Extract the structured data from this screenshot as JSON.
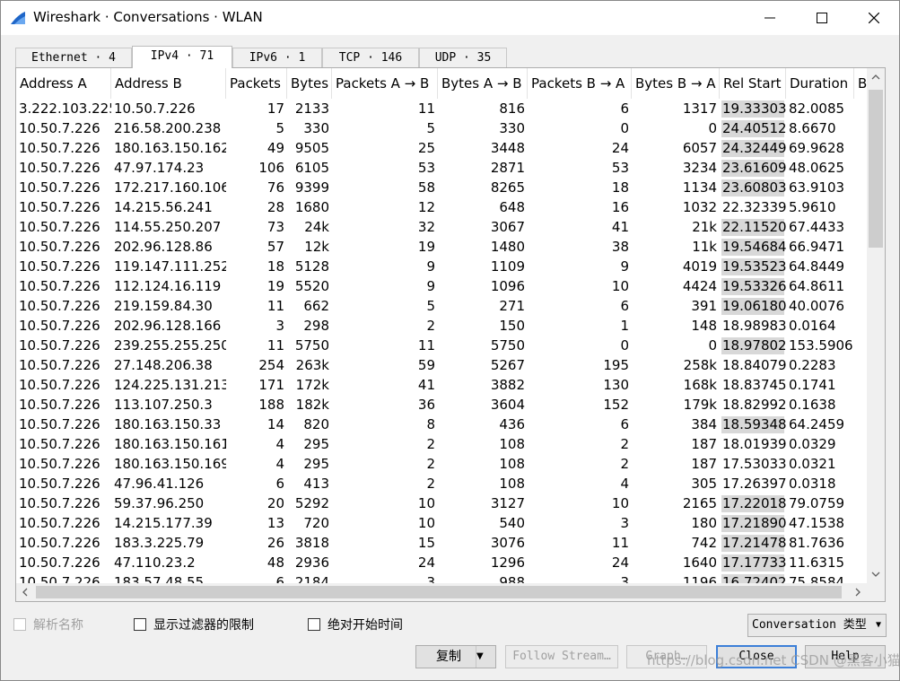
{
  "window": {
    "title": "Wireshark · Conversations · WLAN"
  },
  "tabs": [
    {
      "label": "Ethernet · 4"
    },
    {
      "label": "IPv4 · 71"
    },
    {
      "label": "IPv6 · 1"
    },
    {
      "label": "TCP · 146"
    },
    {
      "label": "UDP · 35"
    }
  ],
  "active_tab": "IPv4 · 71",
  "columns": [
    {
      "label": "Address A"
    },
    {
      "label": "Address B"
    },
    {
      "label": "Packets"
    },
    {
      "label": "Bytes"
    },
    {
      "label": "Packets A → B"
    },
    {
      "label": "Bytes A → B"
    },
    {
      "label": "Packets B → A"
    },
    {
      "label": "Bytes B → A"
    },
    {
      "label": "Rel Start"
    },
    {
      "label": "Duration"
    },
    {
      "label": "B"
    }
  ],
  "rows": [
    {
      "a": "3.222.103.225",
      "b": "10.50.7.226",
      "packets": "17",
      "bytes": "2133",
      "pab": "11",
      "bab": "816",
      "pba": "6",
      "bba": "1317",
      "rel": "19.333035",
      "dur": "82.0085",
      "shaded": true
    },
    {
      "a": "10.50.7.226",
      "b": "216.58.200.238",
      "packets": "5",
      "bytes": "330",
      "pab": "5",
      "bab": "330",
      "pba": "0",
      "bba": "0",
      "rel": "24.405121",
      "dur": "8.6670",
      "shaded": true
    },
    {
      "a": "10.50.7.226",
      "b": "180.163.150.162",
      "packets": "49",
      "bytes": "9505",
      "pab": "25",
      "bab": "3448",
      "pba": "24",
      "bba": "6057",
      "rel": "24.324493",
      "dur": "69.9628",
      "shaded": true
    },
    {
      "a": "10.50.7.226",
      "b": "47.97.174.23",
      "packets": "106",
      "bytes": "6105",
      "pab": "53",
      "bab": "2871",
      "pba": "53",
      "bba": "3234",
      "rel": "23.616092",
      "dur": "48.0625",
      "shaded": true
    },
    {
      "a": "10.50.7.226",
      "b": "172.217.160.106",
      "packets": "76",
      "bytes": "9399",
      "pab": "58",
      "bab": "8265",
      "pba": "18",
      "bba": "1134",
      "rel": "23.608031",
      "dur": "63.9103",
      "shaded": true
    },
    {
      "a": "10.50.7.226",
      "b": "14.215.56.241",
      "packets": "28",
      "bytes": "1680",
      "pab": "12",
      "bab": "648",
      "pba": "16",
      "bba": "1032",
      "rel": "22.323399",
      "dur": "5.9610",
      "shaded": false
    },
    {
      "a": "10.50.7.226",
      "b": "114.55.250.207",
      "packets": "73",
      "bytes": "24k",
      "pab": "32",
      "bab": "3067",
      "pba": "41",
      "bba": "21k",
      "rel": "22.115201",
      "dur": "67.4433",
      "shaded": true
    },
    {
      "a": "10.50.7.226",
      "b": "202.96.128.86",
      "packets": "57",
      "bytes": "12k",
      "pab": "19",
      "bab": "1480",
      "pba": "38",
      "bba": "11k",
      "rel": "19.546843",
      "dur": "66.9471",
      "shaded": true
    },
    {
      "a": "10.50.7.226",
      "b": "119.147.111.252",
      "packets": "18",
      "bytes": "5128",
      "pab": "9",
      "bab": "1109",
      "pba": "9",
      "bba": "4019",
      "rel": "19.535235",
      "dur": "64.8449",
      "shaded": true
    },
    {
      "a": "10.50.7.226",
      "b": "112.124.16.119",
      "packets": "19",
      "bytes": "5520",
      "pab": "9",
      "bab": "1096",
      "pba": "10",
      "bba": "4424",
      "rel": "19.533265",
      "dur": "64.8611",
      "shaded": true
    },
    {
      "a": "10.50.7.226",
      "b": "219.159.84.30",
      "packets": "11",
      "bytes": "662",
      "pab": "5",
      "bab": "271",
      "pba": "6",
      "bba": "391",
      "rel": "19.061807",
      "dur": "40.0076",
      "shaded": true
    },
    {
      "a": "10.50.7.226",
      "b": "202.96.128.166",
      "packets": "3",
      "bytes": "298",
      "pab": "2",
      "bab": "150",
      "pba": "1",
      "bba": "148",
      "rel": "18.989830",
      "dur": "0.0164",
      "shaded": false
    },
    {
      "a": "10.50.7.226",
      "b": "239.255.255.250",
      "packets": "11",
      "bytes": "5750",
      "pab": "11",
      "bab": "5750",
      "pba": "0",
      "bba": "0",
      "rel": "18.978021",
      "dur": "153.5906",
      "shaded": true
    },
    {
      "a": "10.50.7.226",
      "b": "27.148.206.38",
      "packets": "254",
      "bytes": "263k",
      "pab": "59",
      "bab": "5267",
      "pba": "195",
      "bba": "258k",
      "rel": "18.840791",
      "dur": "0.2283",
      "shaded": false
    },
    {
      "a": "10.50.7.226",
      "b": "124.225.131.213",
      "packets": "171",
      "bytes": "172k",
      "pab": "41",
      "bab": "3882",
      "pba": "130",
      "bba": "168k",
      "rel": "18.837457",
      "dur": "0.1741",
      "shaded": false
    },
    {
      "a": "10.50.7.226",
      "b": "113.107.250.3",
      "packets": "188",
      "bytes": "182k",
      "pab": "36",
      "bab": "3604",
      "pba": "152",
      "bba": "179k",
      "rel": "18.829926",
      "dur": "0.1638",
      "shaded": false
    },
    {
      "a": "10.50.7.226",
      "b": "180.163.150.33",
      "packets": "14",
      "bytes": "820",
      "pab": "8",
      "bab": "436",
      "pba": "6",
      "bba": "384",
      "rel": "18.593487",
      "dur": "64.2459",
      "shaded": true
    },
    {
      "a": "10.50.7.226",
      "b": "180.163.150.161",
      "packets": "4",
      "bytes": "295",
      "pab": "2",
      "bab": "108",
      "pba": "2",
      "bba": "187",
      "rel": "18.019391",
      "dur": "0.0329",
      "shaded": false
    },
    {
      "a": "10.50.7.226",
      "b": "180.163.150.169",
      "packets": "4",
      "bytes": "295",
      "pab": "2",
      "bab": "108",
      "pba": "2",
      "bba": "187",
      "rel": "17.530334",
      "dur": "0.0321",
      "shaded": false
    },
    {
      "a": "10.50.7.226",
      "b": "47.96.41.126",
      "packets": "6",
      "bytes": "413",
      "pab": "2",
      "bab": "108",
      "pba": "4",
      "bba": "305",
      "rel": "17.263975",
      "dur": "0.0318",
      "shaded": false
    },
    {
      "a": "10.50.7.226",
      "b": "59.37.96.250",
      "packets": "20",
      "bytes": "5292",
      "pab": "10",
      "bab": "3127",
      "pba": "10",
      "bba": "2165",
      "rel": "17.220183",
      "dur": "79.0759",
      "shaded": true
    },
    {
      "a": "10.50.7.226",
      "b": "14.215.177.39",
      "packets": "13",
      "bytes": "720",
      "pab": "10",
      "bab": "540",
      "pba": "3",
      "bba": "180",
      "rel": "17.218901",
      "dur": "47.1538",
      "shaded": true
    },
    {
      "a": "10.50.7.226",
      "b": "183.3.225.79",
      "packets": "26",
      "bytes": "3818",
      "pab": "15",
      "bab": "3076",
      "pba": "11",
      "bba": "742",
      "rel": "17.214786",
      "dur": "81.7636",
      "shaded": true
    },
    {
      "a": "10.50.7.226",
      "b": "47.110.23.2",
      "packets": "48",
      "bytes": "2936",
      "pab": "24",
      "bab": "1296",
      "pba": "24",
      "bba": "1640",
      "rel": "17.177339",
      "dur": "11.6315",
      "shaded": true
    },
    {
      "a": "10.50.7.226",
      "b": "183.57.48.55",
      "packets": "6",
      "bytes": "2184",
      "pab": "3",
      "bab": "988",
      "pba": "3",
      "bba": "1196",
      "rel": "16.724020",
      "dur": "75.8584",
      "shaded": true
    }
  ],
  "options": {
    "resolve_names": "解析名称",
    "limit_to_filter": "显示过滤器的限制",
    "absolute_start": "绝对开始时间"
  },
  "conversation_type": "Conversation 类型",
  "buttons": {
    "copy": "复制",
    "follow_stream": "Follow Stream…",
    "graph": "Graph…",
    "close": "Close",
    "help": "Help"
  },
  "watermark": "https://blog.csdn.net CSDN @黑客小猫子",
  "colors": {
    "accent": "#3c7fd8",
    "shade": "#d8d8d8",
    "disabled_text": "#a0a0a0"
  }
}
